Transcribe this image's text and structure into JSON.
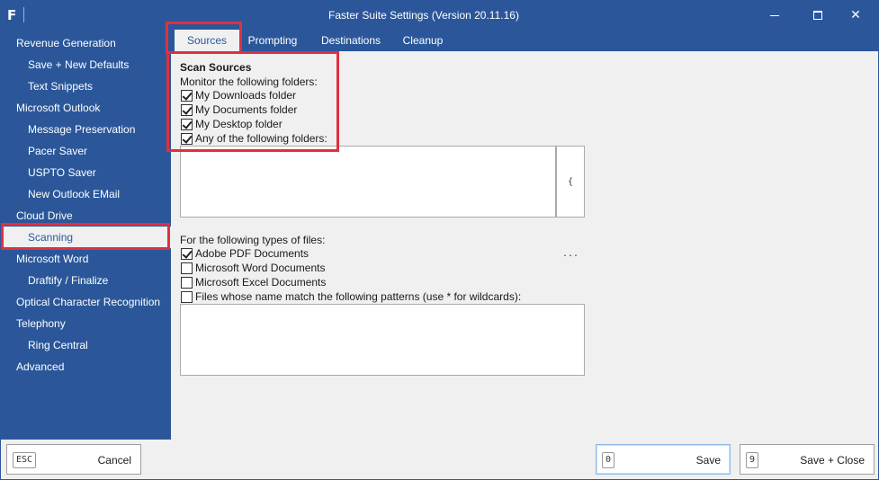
{
  "window": {
    "title": "Faster Suite Settings (Version 20.11.16)",
    "logo": "F",
    "controls": {
      "minimize": "minimize-icon",
      "maximize": "maximize-icon",
      "close": "✕"
    }
  },
  "sidebar": {
    "items": [
      {
        "label": "Revenue Generation",
        "level": 1
      },
      {
        "label": "Save + New Defaults",
        "level": 2
      },
      {
        "label": "Text Snippets",
        "level": 2
      },
      {
        "label": "Microsoft Outlook",
        "level": 1
      },
      {
        "label": "Message Preservation",
        "level": 2
      },
      {
        "label": "Pacer Saver",
        "level": 2
      },
      {
        "label": "USPTO Saver",
        "level": 2
      },
      {
        "label": "New Outlook EMail",
        "level": 2
      },
      {
        "label": "Cloud Drive",
        "level": 1
      },
      {
        "label": "Scanning",
        "level": 2,
        "selected": true
      },
      {
        "label": "Microsoft Word",
        "level": 1
      },
      {
        "label": "Draftify / Finalize",
        "level": 2
      },
      {
        "label": "Optical Character Recognition",
        "level": 1
      },
      {
        "label": "Telephony",
        "level": 1
      },
      {
        "label": "Ring Central",
        "level": 2
      },
      {
        "label": "Advanced",
        "level": 1
      }
    ]
  },
  "tabs": [
    {
      "label": "Sources",
      "active": true
    },
    {
      "label": "Prompting"
    },
    {
      "label": "Destinations"
    },
    {
      "label": "Cleanup"
    }
  ],
  "sources": {
    "section_title": "Scan Sources",
    "monitor_label": "Monitor the following folders:",
    "folders": [
      {
        "label": "My Downloads folder",
        "checked": true
      },
      {
        "label": "My Documents folder",
        "checked": true
      },
      {
        "label": "My Desktop folder",
        "checked": true
      },
      {
        "label": "Any of the following folders:",
        "checked": true
      }
    ],
    "folders_list_value": "",
    "browse_label": "{ ... }",
    "file_types_label": "For the following types of files:",
    "file_types": [
      {
        "label": "Adobe PDF Documents",
        "checked": true
      },
      {
        "label": "Microsoft Word Documents",
        "checked": false
      },
      {
        "label": "Microsoft Excel Documents",
        "checked": false
      },
      {
        "label": "Files whose name match the following patterns (use * for wildcards):",
        "checked": false
      }
    ],
    "patterns_value": ""
  },
  "footer": {
    "cancel": {
      "key": "ESC",
      "label": "Cancel"
    },
    "save": {
      "key": "0",
      "label": "Save"
    },
    "save_close": {
      "key": "9",
      "label": "Save + Close"
    }
  },
  "colors": {
    "accent": "#2b579a",
    "highlight": "#e0303f",
    "background": "#f0f0f0"
  }
}
